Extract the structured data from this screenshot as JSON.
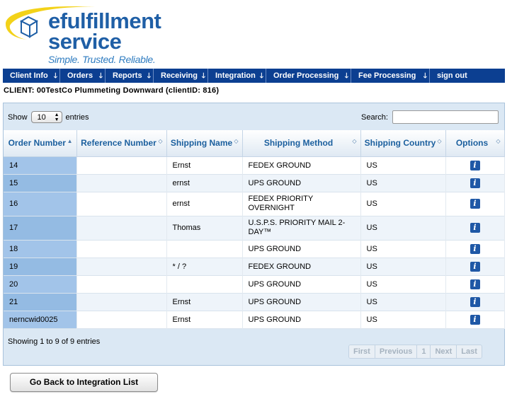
{
  "logo": {
    "line1": "efulfillment",
    "line2": "service",
    "tagline": "Simple. Trusted. Reliable."
  },
  "nav": [
    {
      "label": "Client Info"
    },
    {
      "label": "Orders"
    },
    {
      "label": "Reports"
    },
    {
      "label": "Receiving"
    },
    {
      "label": "Integration"
    },
    {
      "label": "Order Processing"
    },
    {
      "label": "Fee Processing"
    },
    {
      "label": "sign out"
    }
  ],
  "client_line": "CLIENT: 00TestCo Plummeting Downward (clientID: 816)",
  "controls": {
    "show_label": "Show",
    "entries_value": "10",
    "entries_label": "entries",
    "search_label": "Search:",
    "search_value": ""
  },
  "table": {
    "headers": [
      "Order Number",
      "Reference Number",
      "Shipping Name",
      "Shipping Method",
      "Shipping Country",
      "Options"
    ],
    "rows": [
      {
        "order": "14",
        "ref": "",
        "name": "Ernst",
        "method": "FEDEX GROUND",
        "country": "US",
        "info": "i"
      },
      {
        "order": "15",
        "ref": "",
        "name": "ernst",
        "method": "UPS GROUND",
        "country": "US",
        "info": "i"
      },
      {
        "order": "16",
        "ref": "",
        "name": "ernst",
        "method": "FEDEX PRIORITY OVERNIGHT",
        "country": "US",
        "info": "i"
      },
      {
        "order": "17",
        "ref": "",
        "name": "Thomas",
        "method": "U.S.P.S. PRIORITY MAIL 2-DAY™",
        "country": "US",
        "info": "i"
      },
      {
        "order": "18",
        "ref": "",
        "name": "",
        "method": "UPS GROUND",
        "country": "US",
        "info": "i"
      },
      {
        "order": "19",
        "ref": "",
        "name": "* / ?",
        "method": "FEDEX GROUND",
        "country": "US",
        "info": "i"
      },
      {
        "order": "20",
        "ref": "",
        "name": "",
        "method": "UPS GROUND",
        "country": "US",
        "info": "i"
      },
      {
        "order": "21",
        "ref": "",
        "name": "Ernst",
        "method": "UPS GROUND",
        "country": "US",
        "info": "i"
      },
      {
        "order": "nerncwid0025",
        "ref": "",
        "name": "Ernst",
        "method": "UPS GROUND",
        "country": "US",
        "info": "i"
      }
    ]
  },
  "footer": {
    "info": "Showing 1 to 9 of 9 entries",
    "pager": [
      "First",
      "Previous",
      "1",
      "Next",
      "Last"
    ]
  },
  "back_button": "Go Back to Integration List",
  "colors": {
    "brand_blue": "#1f5fa6",
    "nav_bg": "#0c3f91",
    "swoosh_yellow": "#f3d219"
  }
}
